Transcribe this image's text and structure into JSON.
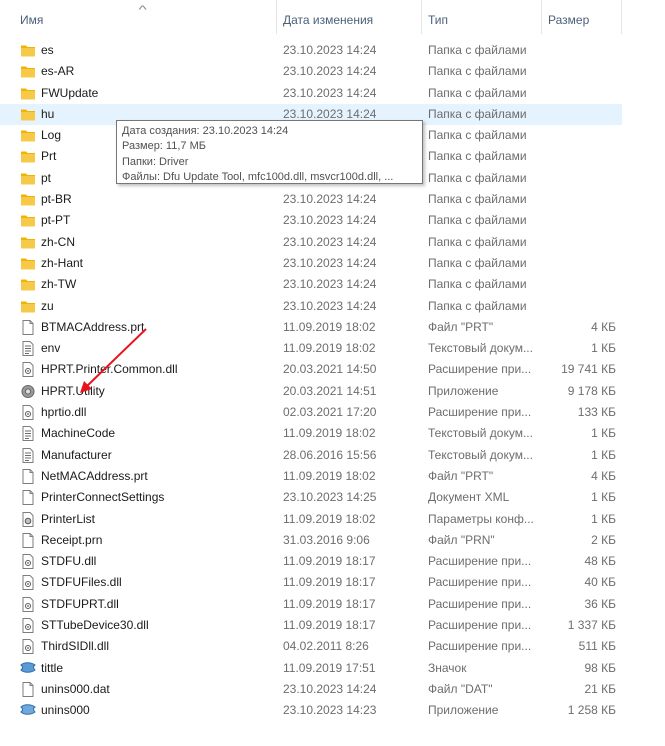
{
  "header": {
    "name": "Имя",
    "date": "Дата изменения",
    "type": "Тип",
    "size": "Размер"
  },
  "files": [
    {
      "name": "es",
      "date": "23.10.2023 14:24",
      "type": "Папка с файлами",
      "size": "",
      "icon": "folder-icon"
    },
    {
      "name": "es-AR",
      "date": "23.10.2023 14:24",
      "type": "Папка с файлами",
      "size": "",
      "icon": "folder-icon"
    },
    {
      "name": "FWUpdate",
      "date": "23.10.2023 14:24",
      "type": "Папка с файлами",
      "size": "",
      "icon": "folder-icon"
    },
    {
      "name": "hu",
      "date": "23.10.2023 14:24",
      "type": "Папка с файлами",
      "size": "",
      "icon": "folder-icon",
      "hover": true
    },
    {
      "name": "Log",
      "date": "",
      "type": "Папка с файлами",
      "size": "",
      "icon": "folder-icon"
    },
    {
      "name": "Prt",
      "date": "",
      "type": "Папка с файлами",
      "size": "",
      "icon": "folder-icon"
    },
    {
      "name": "pt",
      "date": "",
      "type": "Папка с файлами",
      "size": "",
      "icon": "folder-icon"
    },
    {
      "name": "pt-BR",
      "date": "23.10.2023 14:24",
      "type": "Папка с файлами",
      "size": "",
      "icon": "folder-icon"
    },
    {
      "name": "pt-PT",
      "date": "23.10.2023 14:24",
      "type": "Папка с файлами",
      "size": "",
      "icon": "folder-icon"
    },
    {
      "name": "zh-CN",
      "date": "23.10.2023 14:24",
      "type": "Папка с файлами",
      "size": "",
      "icon": "folder-icon"
    },
    {
      "name": "zh-Hant",
      "date": "23.10.2023 14:24",
      "type": "Папка с файлами",
      "size": "",
      "icon": "folder-icon"
    },
    {
      "name": "zh-TW",
      "date": "23.10.2023 14:24",
      "type": "Папка с файлами",
      "size": "",
      "icon": "folder-icon"
    },
    {
      "name": "zu",
      "date": "23.10.2023 14:24",
      "type": "Папка с файлами",
      "size": "",
      "icon": "folder-icon"
    },
    {
      "name": "BTMACAddress.prt",
      "date": "11.09.2019 18:02",
      "type": "Файл \"PRT\"",
      "size": "4 КБ",
      "icon": "document-icon"
    },
    {
      "name": "env",
      "date": "11.09.2019 18:02",
      "type": "Текстовый докум...",
      "size": "1 КБ",
      "icon": "text-file-icon"
    },
    {
      "name": "HPRT.Printer.Common.dll",
      "date": "20.03.2021 14:50",
      "type": "Расширение при...",
      "size": "19 741 КБ",
      "icon": "dll-file-icon"
    },
    {
      "name": "HPRT.Utility",
      "date": "20.03.2021 14:51",
      "type": "Приложение",
      "size": "9 178 КБ",
      "icon": "gear-app-icon"
    },
    {
      "name": "hprtio.dll",
      "date": "02.03.2021 17:20",
      "type": "Расширение при...",
      "size": "133 КБ",
      "icon": "dll-file-icon"
    },
    {
      "name": "MachineCode",
      "date": "11.09.2019 18:02",
      "type": "Текстовый докум...",
      "size": "1 КБ",
      "icon": "text-file-icon"
    },
    {
      "name": "Manufacturer",
      "date": "28.06.2016 15:56",
      "type": "Текстовый докум...",
      "size": "1 КБ",
      "icon": "text-file-icon"
    },
    {
      "name": "NetMACAddress.prt",
      "date": "11.09.2019 18:02",
      "type": "Файл \"PRT\"",
      "size": "4 КБ",
      "icon": "document-icon"
    },
    {
      "name": "PrinterConnectSettings",
      "date": "23.10.2023 14:25",
      "type": "Документ XML",
      "size": "1 КБ",
      "icon": "document-icon"
    },
    {
      "name": "PrinterList",
      "date": "11.09.2019 18:02",
      "type": "Параметры конф...",
      "size": "1 КБ",
      "icon": "config-file-icon"
    },
    {
      "name": "Receipt.prn",
      "date": "31.03.2016 9:06",
      "type": "Файл \"PRN\"",
      "size": "2 КБ",
      "icon": "document-icon"
    },
    {
      "name": "STDFU.dll",
      "date": "11.09.2019 18:17",
      "type": "Расширение при...",
      "size": "48 КБ",
      "icon": "dll-file-icon"
    },
    {
      "name": "STDFUFiles.dll",
      "date": "11.09.2019 18:17",
      "type": "Расширение при...",
      "size": "40 КБ",
      "icon": "dll-file-icon"
    },
    {
      "name": "STDFUPRT.dll",
      "date": "11.09.2019 18:17",
      "type": "Расширение при...",
      "size": "36 КБ",
      "icon": "dll-file-icon"
    },
    {
      "name": "STTubeDevice30.dll",
      "date": "11.09.2019 18:17",
      "type": "Расширение при...",
      "size": "1 337 КБ",
      "icon": "dll-file-icon"
    },
    {
      "name": "ThirdSIDll.dll",
      "date": "04.02.2011 8:26",
      "type": "Расширение при...",
      "size": "511 КБ",
      "icon": "dll-file-icon"
    },
    {
      "name": "tittle",
      "date": "11.09.2019 17:51",
      "type": "Значок",
      "size": "98 КБ",
      "icon": "image-icon"
    },
    {
      "name": "unins000.dat",
      "date": "23.10.2023 14:24",
      "type": "Файл \"DAT\"",
      "size": "21 КБ",
      "icon": "document-icon"
    },
    {
      "name": "unins000",
      "date": "23.10.2023 14:23",
      "type": "Приложение",
      "size": "1 258 КБ",
      "icon": "installer-icon"
    }
  ],
  "tooltip": {
    "created": "Дата создания: 23.10.2023 14:24",
    "size": "Размер: 11,7 МБ",
    "folders": "Папки: Driver",
    "files": "Файлы: Dfu Update Tool, mfc100d.dll, msvcr100d.dll, ..."
  },
  "colors": {
    "hover_bg": "#e5f3ff",
    "folder": "#f7c948",
    "annotation_arrow": "#e8141b"
  }
}
